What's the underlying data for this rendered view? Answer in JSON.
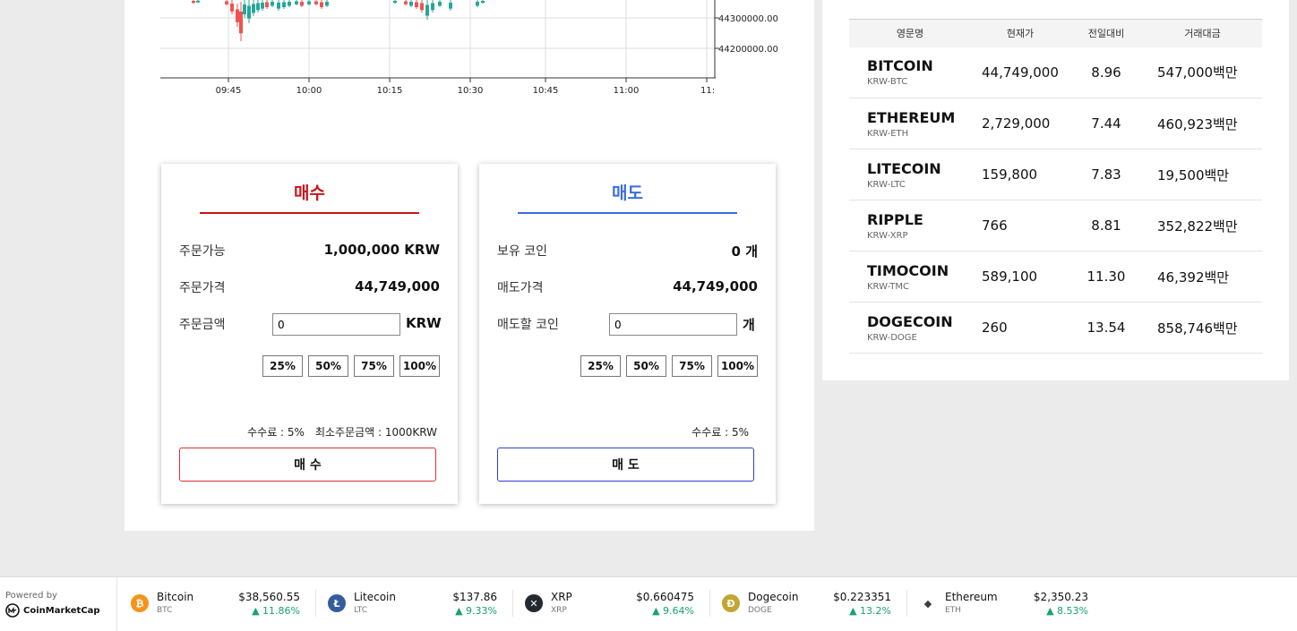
{
  "chart": {
    "y_ticks": [
      "44300000.00",
      "44200000.00"
    ],
    "x_ticks": [
      "09:45",
      "10:00",
      "10:15",
      "10:30",
      "10:45",
      "11:00",
      "11:"
    ]
  },
  "buy": {
    "title": "매수",
    "available_label": "주문가능",
    "available_value": "1,000,000 KRW",
    "price_label": "주문가격",
    "price_value": "44,749,000",
    "amount_label": "주문금액",
    "amount_input": "0",
    "amount_unit": "KRW",
    "pct_buttons": [
      "25%",
      "50%",
      "75%",
      "100%"
    ],
    "fee_text": "수수료 : 5%",
    "min_order_text": "최소주문금액 : 1000KRW",
    "action_label": "매 수"
  },
  "sell": {
    "title": "매도",
    "held_label": "보유 코인",
    "held_value": "0 개",
    "price_label": "매도가격",
    "price_value": "44,749,000",
    "amount_label": "매도할 코인",
    "amount_input": "0",
    "amount_unit": "개",
    "pct_buttons": [
      "25%",
      "50%",
      "75%",
      "100%"
    ],
    "fee_text": "수수료 : 5%",
    "action_label": "매 도"
  },
  "coin_table": {
    "headers": [
      "영문명",
      "현재가",
      "전일대비",
      "거래대금"
    ],
    "rows": [
      {
        "name": "BITCOIN",
        "code": "KRW-BTC",
        "price": "44,749,000",
        "change": "8.96",
        "volume": "547,000백만"
      },
      {
        "name": "ETHEREUM",
        "code": "KRW-ETH",
        "price": "2,729,000",
        "change": "7.44",
        "volume": "460,923백만"
      },
      {
        "name": "LITECOIN",
        "code": "KRW-LTC",
        "price": "159,800",
        "change": "7.83",
        "volume": "19,500백만"
      },
      {
        "name": "RIPPLE",
        "code": "KRW-XRP",
        "price": "766",
        "change": "8.81",
        "volume": "352,822백만"
      },
      {
        "name": "TIMOCOIN",
        "code": "KRW-TMC",
        "price": "589,100",
        "change": "11.30",
        "volume": "46,392백만"
      },
      {
        "name": "DOGECOIN",
        "code": "KRW-DOGE",
        "price": "260",
        "change": "13.54",
        "volume": "858,746백만"
      }
    ]
  },
  "ticker": {
    "powered_label": "Powered by",
    "brand": "CoinMarketCap",
    "items": [
      {
        "name": "Bitcoin",
        "symbol": "BTC",
        "price": "$38,560.55",
        "change": "▲ 11.86%",
        "icon": "bitcoin-icon",
        "color": "#f7931a"
      },
      {
        "name": "Litecoin",
        "symbol": "LTC",
        "price": "$137.86",
        "change": "▲ 9.33%",
        "icon": "litecoin-icon",
        "color": "#345d9d"
      },
      {
        "name": "XRP",
        "symbol": "XRP",
        "price": "$0.660475",
        "change": "▲ 9.64%",
        "icon": "xrp-icon",
        "color": "#23292f"
      },
      {
        "name": "Dogecoin",
        "symbol": "DOGE",
        "price": "$0.223351",
        "change": "▲ 13.2%",
        "icon": "dogecoin-icon",
        "color": "#c2a633"
      },
      {
        "name": "Ethereum",
        "symbol": "ETH",
        "price": "$2,350.23",
        "change": "▲ 8.53%",
        "icon": "ethereum-icon",
        "color": "#3c3c3d"
      }
    ]
  },
  "colors": {
    "buy": "#c8151c",
    "sell": "#3c6cde",
    "up": "#16a46b",
    "candle_up": "#26a69a",
    "candle_down": "#ef5350"
  }
}
